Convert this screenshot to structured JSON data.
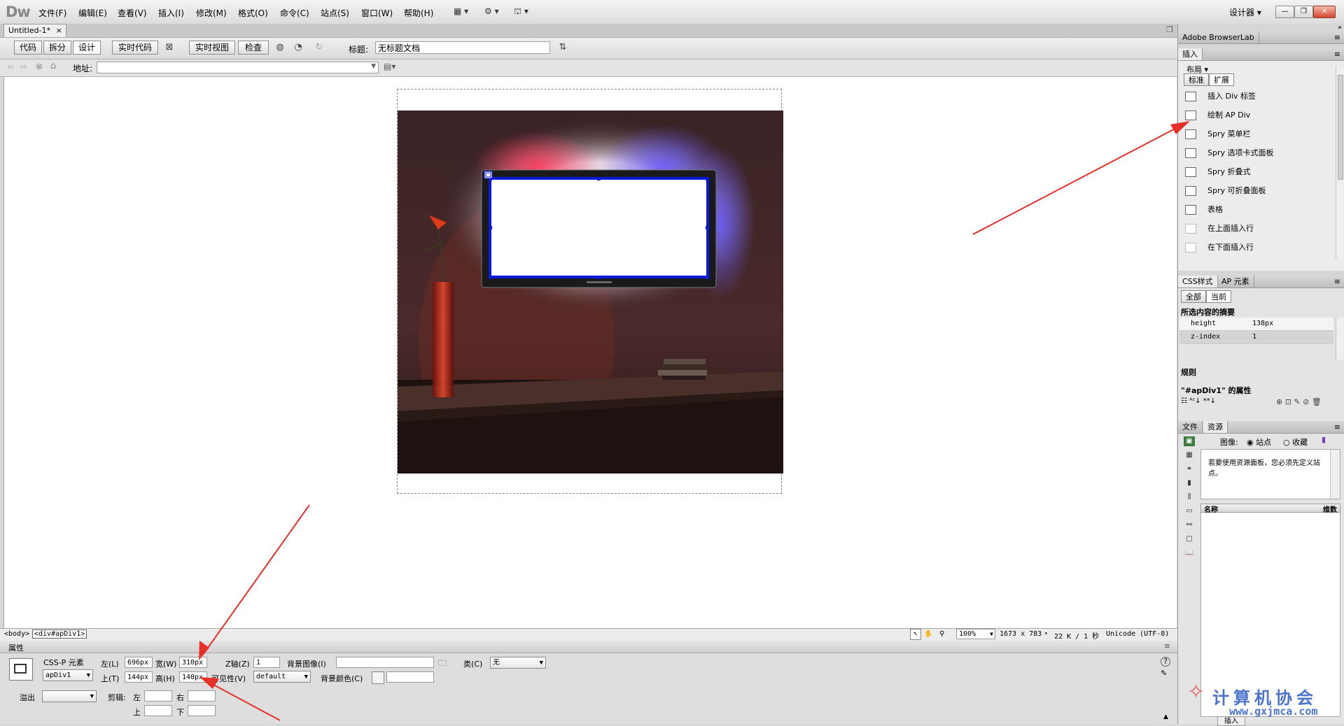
{
  "app": {
    "logo": "Dw",
    "workspace": "设计器 ▾"
  },
  "menu": [
    "文件(F)",
    "编辑(E)",
    "查看(V)",
    "插入(I)",
    "修改(M)",
    "格式(O)",
    "命令(C)",
    "站点(S)",
    "窗口(W)",
    "帮助(H)"
  ],
  "window_controls": {
    "minimize": "—",
    "restore": "❐",
    "close": "✕"
  },
  "document": {
    "tab_name": "Untitled-1*",
    "tab_close": "×"
  },
  "doc_toolbar": {
    "code": "代码",
    "split": "拆分",
    "design": "设计",
    "live_code": "实时代码",
    "live_view": "实时视图",
    "inspect": "检查",
    "title_label": "标题:",
    "title_value": "无标题文档"
  },
  "address": {
    "label": "地址:",
    "value": ""
  },
  "status_bar": {
    "tag_body": "<body>",
    "tag_div": "<div#apDiv1>",
    "zoom": "100%",
    "window_size": "1673 x 783",
    "file_size": "22 K / 1 秒",
    "encoding": "Unicode (UTF-8)"
  },
  "properties": {
    "header": "属性",
    "element_type": "CSS-P 元素",
    "id_value": "apDiv1",
    "left_label": "左(L)",
    "left_value": "696px",
    "width_label": "宽(W)",
    "width_value": "310px",
    "top_label": "上(T)",
    "top_value": "144px",
    "height_label": "高(H)",
    "height_value": "140px",
    "z_label": "Z轴(Z)",
    "z_value": "1",
    "vis_label": "可见性(V)",
    "vis_value": "default",
    "bgimg_label": "背景图像(I)",
    "bgcolor_label": "背景颜色(C)",
    "class_label": "类(C)",
    "class_value": "无",
    "overflow_label": "溢出",
    "clip_label": "剪辑:",
    "clip_left": "左",
    "clip_right": "右",
    "clip_top": "上",
    "clip_bottom": "下"
  },
  "right_panel": {
    "browserlab": "Adobe BrowserLab",
    "insert_tab": "插入",
    "insert_category": "布局",
    "insert_subtabs": [
      "标准",
      "扩展"
    ],
    "insert_items": [
      "插入 Div 标签",
      "绘制 AP Div",
      "Spry 菜单栏",
      "Spry 选项卡式面板",
      "Spry 折叠式",
      "Spry 可折叠面板",
      "表格",
      "在上面插入行",
      "在下面插入行"
    ],
    "css_tabs": [
      "CSS样式",
      "AP 元素"
    ],
    "css_subtabs": [
      "全部",
      "当前"
    ],
    "css_summary_title": "所选内容的摘要",
    "css_props": [
      {
        "name": "height",
        "value": "138px"
      },
      {
        "name": "z-index",
        "value": "1"
      }
    ],
    "rules_title": "规则",
    "props_of": "\"#apDiv1\" 的属性",
    "files_tabs": [
      "文件",
      "资源"
    ],
    "assets_image_label": "图像:",
    "assets_site": "站点",
    "assets_fav": "收藏",
    "assets_message": "若要使用资源面板，您必须先定义站点。",
    "assets_col_name": "名称",
    "assets_col_dim": "维数",
    "assets_insert_btn": "插入"
  },
  "watermark": {
    "text": "计算机协会",
    "url": "www.gxjmca.com"
  }
}
